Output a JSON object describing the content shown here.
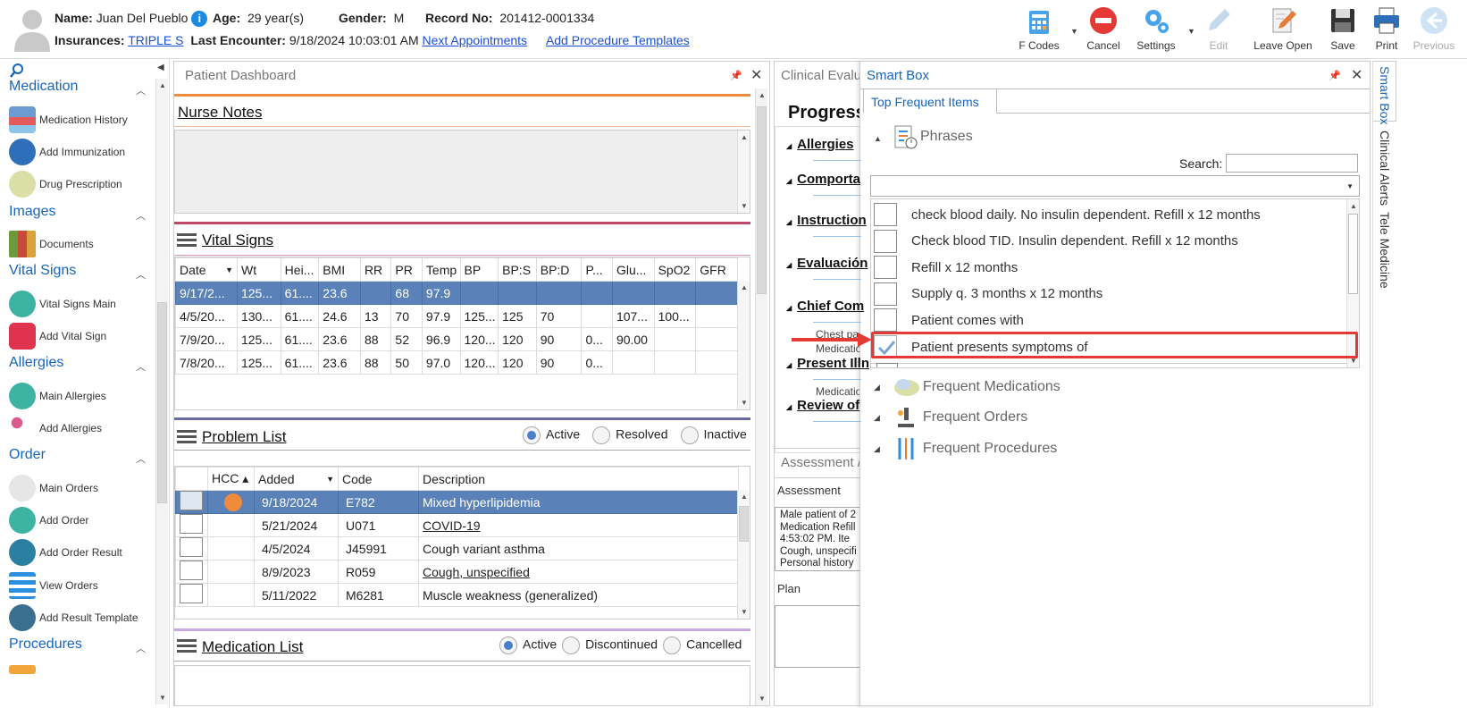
{
  "patient": {
    "name_label": "Name:",
    "name": "Juan Del Pueblo",
    "age_label": "Age:",
    "age": "29 year(s)",
    "gender_label": "Gender:",
    "gender": "M",
    "record_label": "Record No:",
    "record": "201412-0001334",
    "insurances_label": "Insurances:",
    "insurance": "TRIPLE S",
    "last_encounter_label": "Last Encounter:",
    "last_encounter": "9/18/2024 10:03:01 AM",
    "next_appointments": "Next Appointments",
    "add_procedure_templates": "Add Procedure Templates"
  },
  "toolbar": {
    "fcodes": "F Codes",
    "cancel": "Cancel",
    "settings": "Settings",
    "edit": "Edit",
    "leave_open": "Leave Open",
    "save": "Save",
    "print": "Print",
    "previous": "Previous"
  },
  "nav": {
    "medication": {
      "title": "Medication",
      "items": [
        "Medication History",
        "Add Immunization",
        "Drug Prescription"
      ]
    },
    "images": {
      "title": "Images",
      "items": [
        "Documents"
      ]
    },
    "vital_signs": {
      "title": "Vital Signs",
      "items": [
        "Vital Signs Main",
        "Add Vital Sign"
      ]
    },
    "allergies": {
      "title": "Allergies",
      "items": [
        "Main Allergies",
        "Add Allergies"
      ]
    },
    "order": {
      "title": "Order",
      "items": [
        "Main Orders",
        "Add Order",
        "Add Order Result",
        "View Orders",
        "Add Result Template"
      ]
    },
    "procedures": {
      "title": "Procedures"
    }
  },
  "dashboard": {
    "title": "Patient Dashboard",
    "nurse_notes": "Nurse Notes",
    "vital_signs": "Vital Signs",
    "vital_columns": [
      "Date",
      "Wt",
      "Hei...",
      "BMI",
      "RR",
      "PR",
      "Temp",
      "BP",
      "BP:S",
      "BP:D",
      "P...",
      "Glu...",
      "SpO2",
      "GFR"
    ],
    "vital_rows": [
      [
        "9/17/2...",
        "125...",
        "61....",
        "23.6",
        "",
        "68",
        "97.9",
        "",
        "",
        "",
        "",
        "",
        "",
        ""
      ],
      [
        "4/5/20...",
        "130...",
        "61....",
        "24.6",
        "13",
        "70",
        "97.9",
        "125...",
        "125",
        "70",
        "",
        "107...",
        "100...",
        ""
      ],
      [
        "7/9/20...",
        "125...",
        "61....",
        "23.6",
        "88",
        "52",
        "96.9",
        "120...",
        "120",
        "90",
        "0...",
        "90.00",
        "",
        ""
      ],
      [
        "7/8/20...",
        "125...",
        "61....",
        "23.6",
        "88",
        "50",
        "97.0",
        "120...",
        "120",
        "90",
        "0...",
        "",
        "",
        ""
      ]
    ],
    "problem_list": "Problem List",
    "problem_filters": [
      "Active",
      "Resolved",
      "Inactive"
    ],
    "problem_columns": [
      "HCC",
      "Added",
      "Code",
      "Description"
    ],
    "problem_rows": [
      {
        "added": "9/18/2024",
        "code": "E782",
        "desc": "Mixed hyperlipidemia"
      },
      {
        "added": "5/21/2024",
        "code": "U071",
        "desc": "COVID-19"
      },
      {
        "added": "4/5/2024",
        "code": "J45991",
        "desc": "Cough variant asthma"
      },
      {
        "added": "8/9/2023",
        "code": "R059",
        "desc": "Cough, unspecified"
      },
      {
        "added": "5/11/2022",
        "code": "M6281",
        "desc": "Muscle weakness (generalized)"
      }
    ],
    "medication_list": "Medication List",
    "med_filters": [
      "Active",
      "Discontinued",
      "Cancelled"
    ]
  },
  "clinical": {
    "title": "Clinical Evalua",
    "progress": "Progress",
    "sections": [
      "Allergies",
      "Comporta",
      "Instruction",
      "Evaluación",
      "Chief Com",
      "Present Illn",
      "Review of"
    ],
    "chest_pain": "Chest pai",
    "medicatio1": "Medicatio",
    "medicatio2": "Medicatio",
    "assessment_header": "Assessment /",
    "assessment_label": "Assessment",
    "assessment_lines": [
      "Male patient of 2",
      "Medication Refill",
      "4:53:02 PM.   Ite",
      "Cough, unspecifi",
      "Personal history"
    ],
    "plan_label": "Plan"
  },
  "smartbox": {
    "title": "Smart Box",
    "tab": "Top Frequent Items",
    "phrases": "Phrases",
    "search_label": "Search:",
    "phrases_list": [
      "check blood daily. No insulin dependent. Refill x 12 months",
      "Check blood TID. Insulin dependent. Refill x 12 months",
      "Refill x 12 months",
      "Supply q. 3 months x 12 months",
      "Patient comes with",
      "Patient presents symptoms of"
    ],
    "frequent_medications": "Frequent Medications",
    "frequent_orders": "Frequent Orders",
    "frequent_procedures": "Frequent Procedures"
  },
  "side_tabs": [
    "Smart Box",
    "Clinical Alerts",
    "Tele Medicine"
  ],
  "colors": {
    "accent": "#1565c0",
    "selected_row": "#5b82b8",
    "highlight": "#e53935"
  }
}
